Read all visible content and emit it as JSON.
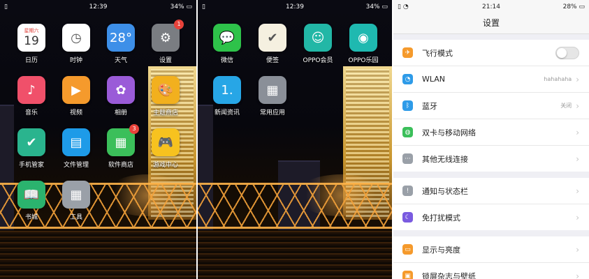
{
  "screen1": {
    "status": {
      "time": "12:39",
      "battery": "34%"
    },
    "apps": [
      {
        "label": "日历",
        "glyph": "19",
        "sub": "星期六",
        "color": "#ffffff"
      },
      {
        "label": "时钟",
        "glyph": "◷",
        "color": "#ffffff"
      },
      {
        "label": "天气",
        "glyph": "28°",
        "color": "#3d8fe8"
      },
      {
        "label": "设置",
        "glyph": "⚙",
        "color": "#7a7d82",
        "badge": "1"
      },
      {
        "label": "音乐",
        "glyph": "♪",
        "color": "#f0506a"
      },
      {
        "label": "视频",
        "glyph": "▶",
        "color": "#f59a2c"
      },
      {
        "label": "相册",
        "glyph": "✿",
        "color": "#9a5bd8"
      },
      {
        "label": "主题商店",
        "glyph": "🎨",
        "color": "#f2b01e"
      },
      {
        "label": "手机管家",
        "glyph": "✔",
        "color": "#2ab48e"
      },
      {
        "label": "文件管理",
        "glyph": "▤",
        "color": "#1e9be8"
      },
      {
        "label": "软件商店",
        "glyph": "▦",
        "color": "#3bbf5a",
        "badge": "3"
      },
      {
        "label": "游戏中心",
        "glyph": "🎮",
        "color": "#f7c21f"
      },
      {
        "label": "书城",
        "glyph": "📖",
        "color": "#2bb36e"
      },
      {
        "label": "工具",
        "glyph": "▦",
        "color": "#9aa0a8"
      }
    ]
  },
  "screen2": {
    "status": {
      "time": "12:39",
      "battery": "34%"
    },
    "apps": [
      {
        "label": "微信",
        "glyph": "💬",
        "color": "#2ec24a"
      },
      {
        "label": "便签",
        "glyph": "✔",
        "color": "#f5f0e0"
      },
      {
        "label": "OPPO会员",
        "glyph": "☺",
        "color": "#22b7a6"
      },
      {
        "label": "OPPO乐园",
        "glyph": "◉",
        "color": "#1fb9b0"
      },
      {
        "label": "新闻资讯",
        "glyph": "1.",
        "color": "#27a6e6"
      },
      {
        "label": "常用应用",
        "glyph": "▦",
        "color": "#8a8f98"
      }
    ]
  },
  "settings": {
    "status": {
      "time": "21:14",
      "battery": "28%"
    },
    "title": "设置",
    "groups": [
      [
        {
          "label": "飞行模式",
          "icon": "airplane-icon",
          "glyph": "✈",
          "color": "#f59a2c",
          "toggle": true
        },
        {
          "label": "WLAN",
          "icon": "wifi-icon",
          "glyph": "◔",
          "color": "#2e9be8",
          "value": "hahahaha"
        },
        {
          "label": "蓝牙",
          "icon": "bluetooth-icon",
          "glyph": "ᛒ",
          "color": "#2e9be8",
          "value": "关闭"
        },
        {
          "label": "双卡与移动网络",
          "icon": "globe-icon",
          "glyph": "◍",
          "color": "#3bbf5a"
        },
        {
          "label": "其他无线连接",
          "icon": "more-icon",
          "glyph": "···",
          "color": "#9aa0a8"
        }
      ],
      [
        {
          "label": "通知与状态栏",
          "icon": "notification-icon",
          "glyph": "!",
          "color": "#9aa0a8"
        },
        {
          "label": "免打扰模式",
          "icon": "moon-icon",
          "glyph": "☾",
          "color": "#7a5be0"
        }
      ],
      [
        {
          "label": "显示与亮度",
          "icon": "display-icon",
          "glyph": "▭",
          "color": "#f59a2c"
        },
        {
          "label": "锁屏杂志与壁纸",
          "icon": "wallpaper-icon",
          "glyph": "▣",
          "color": "#f59a2c"
        }
      ]
    ]
  }
}
